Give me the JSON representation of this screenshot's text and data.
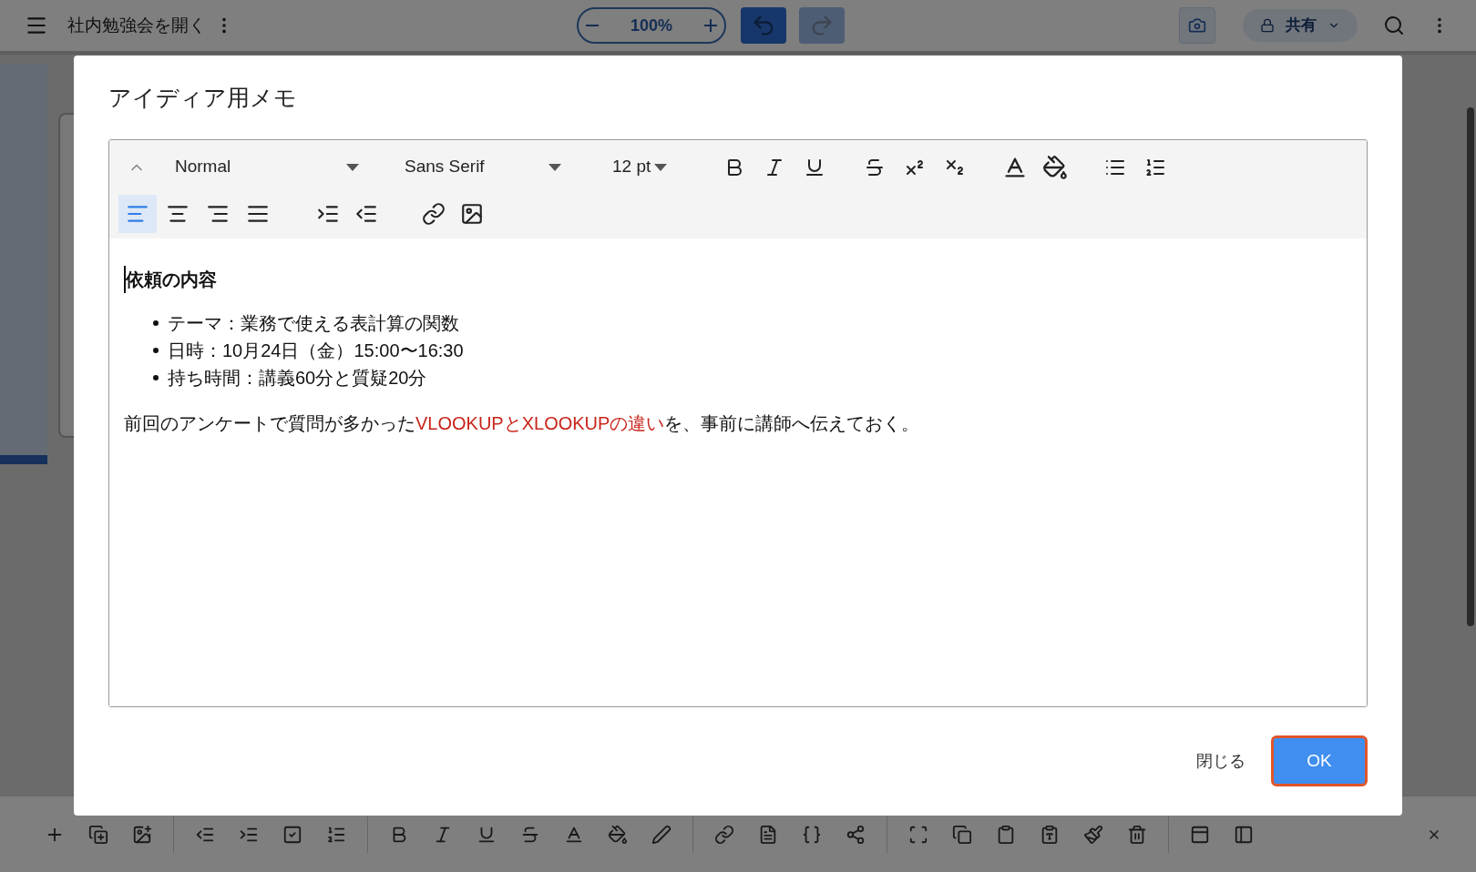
{
  "app_bar": {
    "title": "社内勉強会を開く",
    "zoom": "100%",
    "share": "共有",
    "redo_disabled": true
  },
  "dialog": {
    "title": "アイディア用メモ",
    "toolbar": {
      "style": "Normal",
      "font": "Sans Serif",
      "size": "12 pt",
      "alignments": [
        {
          "selected": true
        },
        {
          "selected": false
        },
        {
          "selected": false
        },
        {
          "selected": false
        }
      ]
    },
    "content": {
      "heading": "依頼の内容",
      "bullets": [
        "テーマ：業務で使える表計算の関数",
        "日時：10月24日（金）15:00〜16:30",
        "持ち時間：講義60分と質疑20分"
      ],
      "paragraph": [
        {
          "text": "前回のアンケートで質問が多かった",
          "highlight": false
        },
        {
          "text": "VLOOKUPとXLOOKUPの違い",
          "highlight": true
        },
        {
          "text": "を、事前に講師へ伝えておく。",
          "highlight": false
        }
      ]
    },
    "buttons": [
      {
        "label": "閉じる",
        "kind": "text"
      },
      {
        "label": "OK",
        "kind": "primary"
      }
    ]
  }
}
